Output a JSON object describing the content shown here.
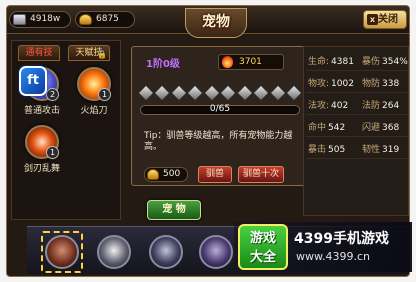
{
  "topbar": {
    "silver": "4918w",
    "gold": "6875",
    "title": "宠物",
    "close_label": "关闭",
    "close_icon": "x"
  },
  "skills": {
    "tabs": [
      {
        "label": "通有技"
      },
      {
        "label": "天赋技"
      }
    ],
    "items": [
      {
        "name": "普通攻击",
        "level": "2"
      },
      {
        "name": "火焰刀",
        "level": "1"
      },
      {
        "name": "剑刃乱舞",
        "level": "1"
      }
    ]
  },
  "app_logo": "ft",
  "pet": {
    "stage": "1阶0级",
    "fire_value": "3701",
    "progress_text": "0/65",
    "progress": 0,
    "tip": "Tip：驯兽等级越高，所有宠物能力越高。",
    "cost": "500",
    "tame_label": "驯兽",
    "tame_ten_label": "驯兽十次",
    "pet_button": "宠 物"
  },
  "stats": [
    [
      {
        "label": "生命:",
        "value": "4381"
      },
      {
        "label": "暴伤",
        "value": "354%"
      }
    ],
    [
      {
        "label": "物攻:",
        "value": "1002"
      },
      {
        "label": "物防",
        "value": "338"
      }
    ],
    [
      {
        "label": "法攻:",
        "value": "402"
      },
      {
        "label": "法防",
        "value": "264"
      }
    ],
    [
      {
        "label": "命中",
        "value": "542"
      },
      {
        "label": "闪避",
        "value": "368"
      }
    ],
    [
      {
        "label": "暴击",
        "value": "505"
      },
      {
        "label": "韧性",
        "value": "319"
      }
    ]
  ],
  "banner": {
    "logo_line1": "游戏",
    "logo_line2": "大全",
    "site_name": "4399手机游戏",
    "site_url": "www.4399.cn"
  },
  "colors": {
    "accent_gold": "#ffd860",
    "danger_red": "#c24030",
    "confirm_green": "#4aa040"
  }
}
